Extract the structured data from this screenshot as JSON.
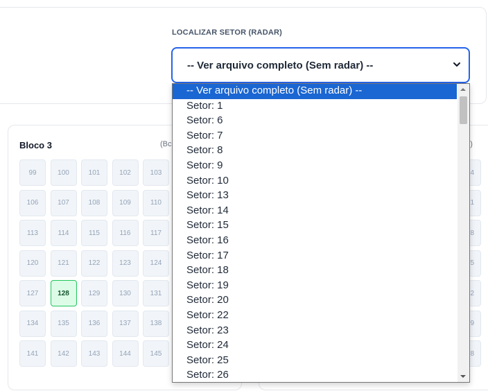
{
  "filter": {
    "label": "LOCALIZAR SETOR (RADAR)",
    "selected": "-- Ver arquivo completo (Sem radar) --",
    "options": [
      "-- Ver arquivo completo (Sem radar) --",
      "Setor: 1",
      "Setor: 6",
      "Setor: 7",
      "Setor: 8",
      "Setor: 9",
      "Setor: 10",
      "Setor: 13",
      "Setor: 14",
      "Setor: 15",
      "Setor: 16",
      "Setor: 17",
      "Setor: 18",
      "Setor: 19",
      "Setor: 20",
      "Setor: 22",
      "Setor: 23",
      "Setor: 24",
      "Setor: 25",
      "Setor: 26"
    ]
  },
  "blocks": {
    "left": {
      "title": "Bloco 3",
      "meta_visible": "(Bc",
      "seats": [
        [
          "99",
          "100",
          "101",
          "102",
          "103"
        ],
        [
          "106",
          "107",
          "108",
          "109",
          "110"
        ],
        [
          "113",
          "114",
          "115",
          "116",
          "117"
        ],
        [
          "120",
          "121",
          "122",
          "123",
          "124"
        ],
        [
          "127",
          "128",
          "129",
          "130",
          "131"
        ],
        [
          "134",
          "135",
          "136",
          "137",
          "138"
        ],
        [
          "141",
          "142",
          "143",
          "144",
          "145"
        ]
      ],
      "highlighted_seat": "128"
    },
    "right": {
      "meta_visible": "96)",
      "seat_fragments": [
        "4",
        "1",
        "8",
        "5",
        "2",
        "9",
        "8"
      ]
    }
  },
  "colors": {
    "accent": "#2563eb",
    "selected_option": "#1a66d2",
    "seat_bg": "#f1f5f9",
    "highlight_bg": "#dcfce7",
    "highlight_border": "#22c55e"
  },
  "icons": {
    "select_caret": "chevron-down-icon",
    "scroll_up": "scroll-up-arrow-icon",
    "scroll_down": "scroll-down-arrow-icon"
  }
}
